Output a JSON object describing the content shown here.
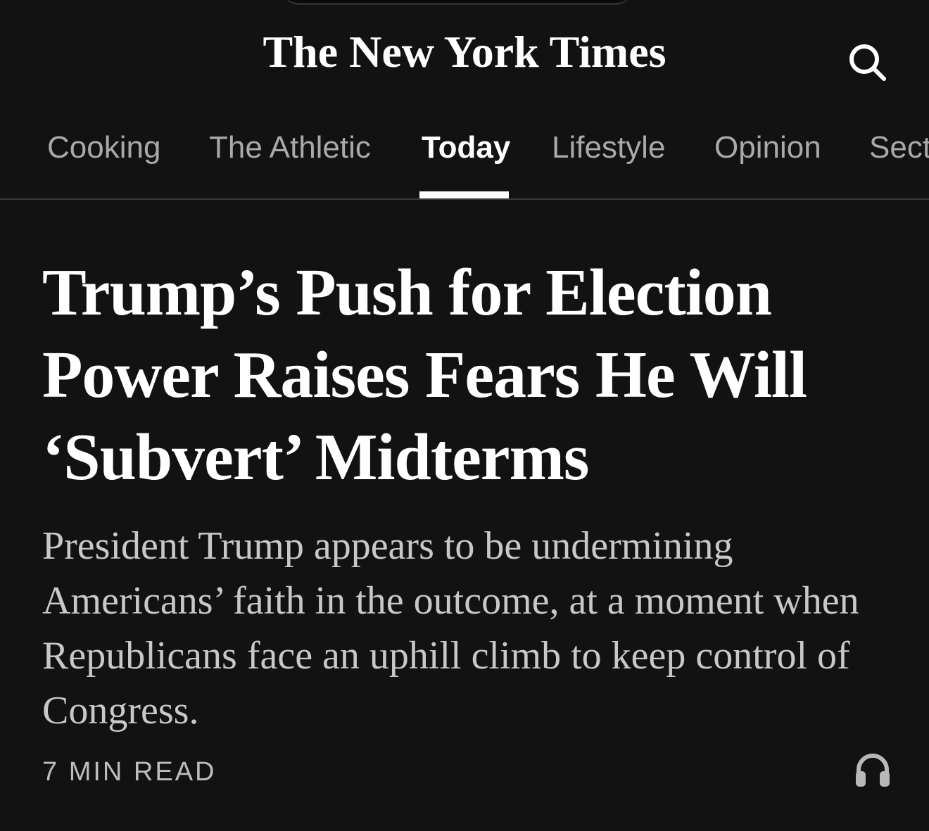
{
  "masthead": {
    "logo_text": "The New York Times"
  },
  "tabs": [
    {
      "label": "Cooking",
      "active": false
    },
    {
      "label": "The Athletic",
      "active": false
    },
    {
      "label": "Today",
      "active": true
    },
    {
      "label": "Lifestyle",
      "active": false
    },
    {
      "label": "Opinion",
      "active": false
    },
    {
      "label": "Sect",
      "active": false
    }
  ],
  "article": {
    "headline": "Trump’s Push for Election Power Raises Fears He Will ‘Subvert’ Midterms",
    "summary": "President Trump appears to be undermining Americans’ faith in the outcome, at a moment when Republicans face an uphill climb to keep control of Congress.",
    "read_time": "7 MIN READ"
  },
  "icons": {
    "search": "search-icon",
    "listen": "headphones-icon"
  },
  "colors": {
    "background": "#121212",
    "active_tab": "#ffffff",
    "inactive_tab": "#a9a9a9",
    "summary_text": "#c8c8c8"
  }
}
